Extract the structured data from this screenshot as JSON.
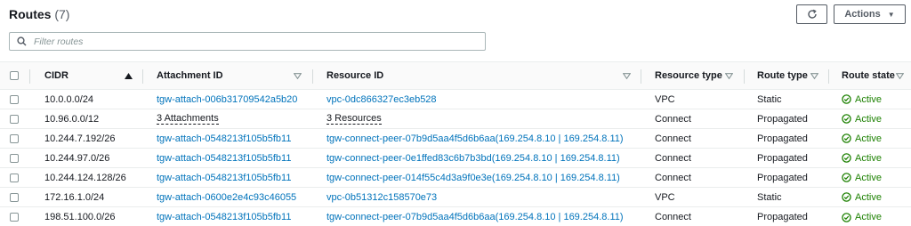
{
  "header": {
    "title": "Routes",
    "count": "(7)"
  },
  "toolbar": {
    "actions_label": "Actions"
  },
  "filter": {
    "placeholder": "Filter routes"
  },
  "columns": {
    "cidr": "CIDR",
    "attachment": "Attachment ID",
    "resource": "Resource ID",
    "resource_type": "Resource type",
    "route_type": "Route type",
    "route_state": "Route state"
  },
  "rows": [
    {
      "cidr": "10.0.0.0/24",
      "attachment": "tgw-attach-006b31709542a5b20",
      "resource": "vpc-0dc866327ec3eb528",
      "resource_type": "VPC",
      "route_type": "Static",
      "route_state": "Active"
    },
    {
      "cidr": "10.96.0.0/12",
      "attachment": "3 Attachments",
      "resource": "3 Resources",
      "resource_type": "Connect",
      "route_type": "Propagated",
      "route_state": "Active"
    },
    {
      "cidr": "10.244.7.192/26",
      "attachment": "tgw-attach-0548213f105b5fb11",
      "resource": "tgw-connect-peer-07b9d5aa4f5d6b6aa(169.254.8.10 | 169.254.8.11)",
      "resource_type": "Connect",
      "route_type": "Propagated",
      "route_state": "Active"
    },
    {
      "cidr": "10.244.97.0/26",
      "attachment": "tgw-attach-0548213f105b5fb11",
      "resource": "tgw-connect-peer-0e1ffed83c6b7b3bd(169.254.8.10 | 169.254.8.11)",
      "resource_type": "Connect",
      "route_type": "Propagated",
      "route_state": "Active"
    },
    {
      "cidr": "10.244.124.128/26",
      "attachment": "tgw-attach-0548213f105b5fb11",
      "resource": "tgw-connect-peer-014f55c4d3a9f0e3e(169.254.8.10 | 169.254.8.11)",
      "resource_type": "Connect",
      "route_type": "Propagated",
      "route_state": "Active"
    },
    {
      "cidr": "172.16.1.0/24",
      "attachment": "tgw-attach-0600e2e4c93c46055",
      "resource": "vpc-0b51312c158570e73",
      "resource_type": "VPC",
      "route_type": "Static",
      "route_state": "Active"
    },
    {
      "cidr": "198.51.100.0/26",
      "attachment": "tgw-attach-0548213f105b5fb11",
      "resource": "tgw-connect-peer-07b9d5aa4f5d6b6aa(169.254.8.10 | 169.254.8.11)",
      "resource_type": "Connect",
      "route_type": "Propagated",
      "route_state": "Active"
    }
  ],
  "colors": {
    "link": "#0073bb",
    "active": "#1d8102",
    "border": "#eaeded"
  },
  "icons": {
    "refresh": "refresh-icon",
    "search": "search-icon",
    "status": "check-circle-icon",
    "sort": "sort-icon"
  }
}
